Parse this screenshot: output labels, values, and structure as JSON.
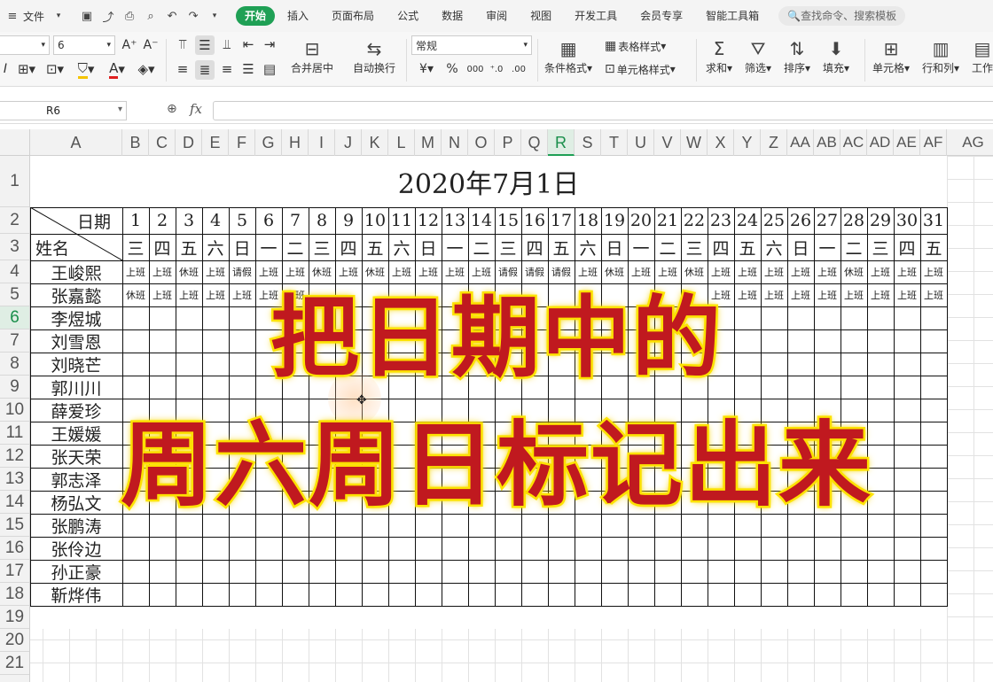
{
  "menu": {
    "file": "文件",
    "tabs": [
      "开始",
      "插入",
      "页面布局",
      "公式",
      "数据",
      "审阅",
      "视图",
      "开发工具",
      "会员专享",
      "智能工具箱"
    ],
    "active_tab": "开始",
    "search_placeholder": "查找命令、搜索模板"
  },
  "ribbon": {
    "font_size": "6",
    "number_format": "常规",
    "merge_center": "合并居中",
    "wrap_text": "自动换行",
    "table_style": "表格样式",
    "cell_style": "单元格样式",
    "cond_format": "条件格式",
    "sum": "求和",
    "filter": "筛选",
    "sort": "排序",
    "fill": "填充",
    "cell": "单元格",
    "row_col": "行和列",
    "worksheet": "工作"
  },
  "formula_bar": {
    "cell_ref": "R6",
    "fx": "fx",
    "content": ""
  },
  "columns": [
    "A",
    "B",
    "C",
    "D",
    "E",
    "F",
    "G",
    "H",
    "I",
    "J",
    "K",
    "L",
    "M",
    "N",
    "O",
    "P",
    "Q",
    "R",
    "S",
    "T",
    "U",
    "V",
    "W",
    "X",
    "Y",
    "Z",
    "AA",
    "AB",
    "AC",
    "AD",
    "AE",
    "AF",
    "AG"
  ],
  "selected_column": "R",
  "rows": [
    "1",
    "2",
    "3",
    "4",
    "5",
    "6",
    "7",
    "8",
    "9",
    "10",
    "11",
    "12",
    "13",
    "14",
    "15",
    "16",
    "17",
    "18",
    "19",
    "20",
    "21"
  ],
  "selected_row": "6",
  "sheet": {
    "title": "2020年7月1日",
    "header_date": "日期",
    "header_name": "姓名",
    "days": [
      "1",
      "2",
      "3",
      "4",
      "5",
      "6",
      "7",
      "8",
      "9",
      "10",
      "11",
      "12",
      "13",
      "14",
      "15",
      "16",
      "17",
      "18",
      "19",
      "20",
      "21",
      "22",
      "23",
      "24",
      "25",
      "26",
      "27",
      "28",
      "29",
      "30",
      "31"
    ],
    "weekdays": [
      "三",
      "四",
      "五",
      "六",
      "日",
      "一",
      "二",
      "三",
      "四",
      "五",
      "六",
      "日",
      "一",
      "二",
      "三",
      "四",
      "五",
      "六",
      "日",
      "一",
      "二",
      "三",
      "四",
      "五",
      "六",
      "日",
      "一",
      "二",
      "三",
      "四",
      "五"
    ],
    "people": [
      {
        "name": "王峻熙",
        "status": [
          "上班",
          "上班",
          "休班",
          "上班",
          "请假",
          "上班",
          "上班",
          "休班",
          "上班",
          "休班",
          "上班",
          "上班",
          "上班",
          "上班",
          "请假",
          "请假",
          "请假",
          "上班",
          "休班",
          "上班",
          "上班",
          "休班",
          "上班",
          "上班",
          "上班",
          "上班",
          "上班",
          "休班",
          "上班",
          "上班",
          "上班"
        ]
      },
      {
        "name": "张嘉懿",
        "status": [
          "休班",
          "上班",
          "上班",
          "上班",
          "上班",
          "上班",
          "上班",
          "",
          "",
          "",
          "",
          "",
          "",
          "",
          "",
          "",
          "",
          "",
          "",
          "",
          "",
          "",
          "上班",
          "上班",
          "上班",
          "上班",
          "上班",
          "上班",
          "上班",
          "上班",
          "上班"
        ]
      },
      {
        "name": "李煜城",
        "status": []
      },
      {
        "name": "刘雪恩",
        "status": []
      },
      {
        "name": "刘晓芒",
        "status": []
      },
      {
        "name": "郭川川",
        "status": []
      },
      {
        "name": "薛爱珍",
        "status": []
      },
      {
        "name": "王媛媛",
        "status": []
      },
      {
        "name": "张天荣",
        "status": []
      },
      {
        "name": "郭志泽",
        "status": []
      },
      {
        "name": "杨弘文",
        "status": []
      },
      {
        "name": "张鹏涛",
        "status": []
      },
      {
        "name": "张伶边",
        "status": []
      },
      {
        "name": "孙正豪",
        "status": []
      },
      {
        "name": "靳烨伟",
        "status": []
      }
    ]
  },
  "caption": {
    "line1": "把日期中的",
    "line2": "周六周日标记出来"
  },
  "colors": {
    "accent": "#1fa055",
    "caption_fill": "#c0191f",
    "caption_stroke": "#ffe600"
  }
}
